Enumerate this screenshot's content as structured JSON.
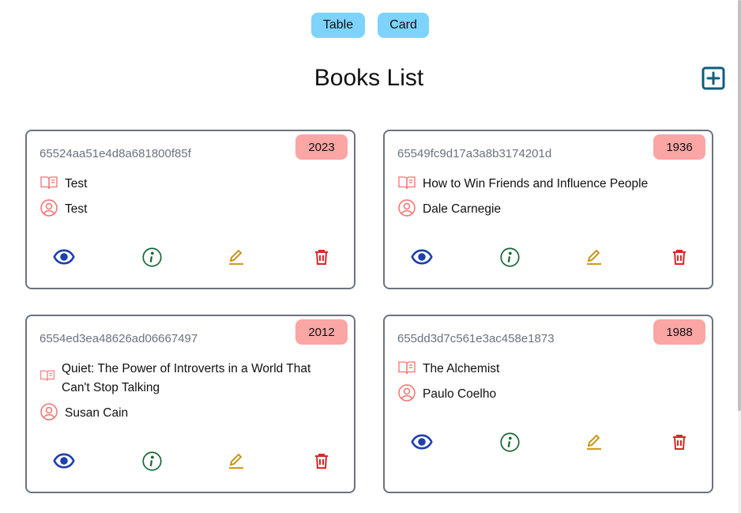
{
  "view_toggle": {
    "table_label": "Table",
    "card_label": "Card"
  },
  "page": {
    "title": "Books List"
  },
  "colors": {
    "toggle_bg": "#7dd3fc",
    "badge_bg": "#fca5a5",
    "meta_icon": "#f87171",
    "view_icon": "#1e40af",
    "info_icon": "#166534",
    "edit_icon": "#ca8a04",
    "delete_icon": "#dc2626",
    "add_icon": "#0e5e7a"
  },
  "icons": {
    "add": "plus-square-icon",
    "title": "book-open-icon",
    "author": "user-circle-icon",
    "view": "eye-icon",
    "info": "info-circle-icon",
    "edit": "pencil-icon",
    "delete": "trash-icon"
  },
  "books": [
    {
      "id": "65524aa51e4d8a681800f85f",
      "year": "2023",
      "title": "Test",
      "author": "Test"
    },
    {
      "id": "65549fc9d17a3a8b3174201d",
      "year": "1936",
      "title": "How to Win Friends and Influence People",
      "author": "Dale Carnegie"
    },
    {
      "id": "6554ed3ea48626ad06667497",
      "year": "2012",
      "title": "Quiet: The Power of Introverts in a World That Can't Stop Talking",
      "author": "Susan Cain"
    },
    {
      "id": "655dd3d7c561e3ac458e1873",
      "year": "1988",
      "title": "The Alchemist",
      "author": "Paulo Coelho"
    }
  ]
}
